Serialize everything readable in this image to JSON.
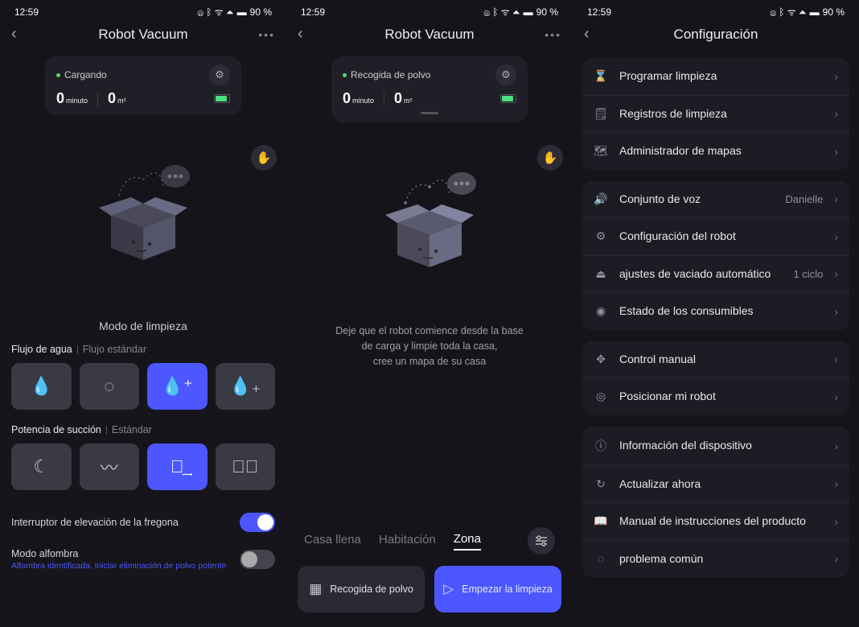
{
  "status": {
    "time": "12:59",
    "battery_pct": "90 %"
  },
  "screen1": {
    "title": "Robot Vacuum",
    "card": {
      "status": "Cargando",
      "time_val": "0",
      "time_unit": "minuto",
      "area_val": "0",
      "area_unit": "m²"
    },
    "sheet_title": "Modo de limpieza",
    "water": {
      "label": "Flujo de agua",
      "value": "Flujo estándar"
    },
    "suction": {
      "label": "Potencia de succión",
      "value": "Estándar"
    },
    "mop_lift": "Interruptor de elevación de la fregona",
    "carpet_mode": "Modo alfombra",
    "carpet_sub": "Alfombra identificada, iniciar eliminación de polvo potente"
  },
  "screen2": {
    "title": "Robot Vacuum",
    "card": {
      "status": "Recogida de polvo",
      "time_val": "0",
      "time_unit": "minuto",
      "area_val": "0",
      "area_unit": "m²"
    },
    "hint_l1": "Deje que el robot comience desde la base",
    "hint_l2": "de carga y limpie toda la casa,",
    "hint_l3": "cree un mapa de su casa",
    "tabs": {
      "full": "Casa llena",
      "room": "Habitación",
      "zone": "Zona"
    },
    "btn_dust": "Recogida de polvo",
    "btn_start": "Empezar la limpieza"
  },
  "screen3": {
    "title": "Configuración",
    "groups": [
      {
        "items": [
          {
            "icon": "⌛",
            "label": "Programar limpieza"
          },
          {
            "icon": "🗒",
            "label": "Registros de limpieza"
          },
          {
            "icon": "🗺",
            "label": "Administrador de mapas"
          }
        ]
      },
      {
        "items": [
          {
            "icon": "🔊",
            "label": "Conjunto de voz",
            "value": "Danielle"
          },
          {
            "icon": "⚙",
            "label": "Configuración del robot"
          },
          {
            "icon": "⏏",
            "label": "ajustes de vaciado automático",
            "value": "1 ciclo"
          },
          {
            "icon": "◉",
            "label": "Estado de los consumibles"
          }
        ]
      },
      {
        "items": [
          {
            "icon": "✥",
            "label": "Control manual"
          },
          {
            "icon": "◎",
            "label": "Posicionar mi robot"
          }
        ]
      },
      {
        "items": [
          {
            "icon": "ⓘ",
            "label": "Información del dispositivo"
          },
          {
            "icon": "↻",
            "label": "Actualizar ahora"
          },
          {
            "icon": "📖",
            "label": "Manual de instrucciones del producto"
          },
          {
            "icon": "◌",
            "label": "problema común"
          }
        ]
      }
    ]
  }
}
